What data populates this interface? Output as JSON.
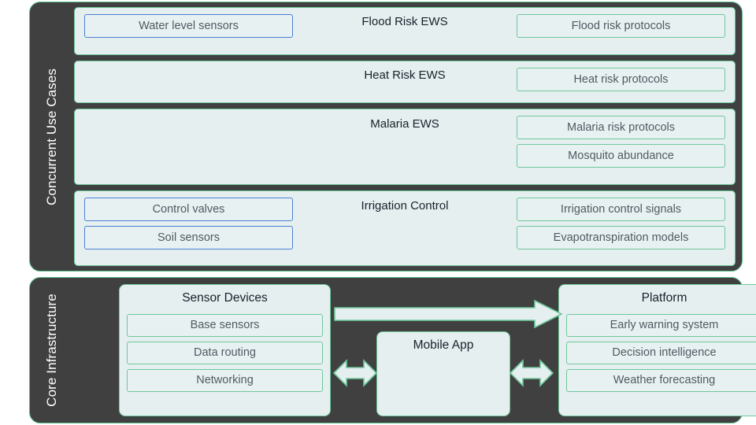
{
  "diagram": {
    "sections": [
      {
        "label": "Concurrent Use Cases",
        "rows": [
          {
            "title": "Flood Risk EWS",
            "left_items": [
              "Water level sensors"
            ],
            "right_items": [
              "Flood risk protocols"
            ]
          },
          {
            "title": "Heat Risk EWS",
            "left_items": [],
            "right_items": [
              "Heat risk protocols"
            ]
          },
          {
            "title": "Malaria EWS",
            "left_items": [],
            "right_items": [
              "Malaria risk protocols",
              "Mosquito abundance"
            ]
          },
          {
            "title": "Irrigation Control",
            "left_items": [
              "Control valves",
              "Soil sensors"
            ],
            "right_items": [
              "Irrigation control signals",
              "Evapotranspiration models"
            ]
          }
        ]
      },
      {
        "label": "Core Infrastructure",
        "boxes": [
          {
            "title": "Sensor Devices",
            "items": [
              "Base sensors",
              "Data routing",
              "Networking"
            ]
          },
          {
            "title": "Mobile App",
            "items": []
          },
          {
            "title": "Platform",
            "items": [
              "Early warning system",
              "Decision intelligence",
              "Weather forecasting"
            ]
          }
        ],
        "arrows": [
          {
            "name": "sensor-to-platform-arrow",
            "direction": "right"
          },
          {
            "name": "sensor-to-mobile-arrow",
            "direction": "both"
          },
          {
            "name": "mobile-to-platform-arrow",
            "direction": "both"
          }
        ]
      }
    ],
    "colors": {
      "panel_background": "#404040",
      "panel_outline": "#5cbf8e",
      "box_fill": "#e5eff0",
      "green_border": "#6fc79b",
      "blue_border": "#4a7fd4",
      "title_text": "#18202a",
      "item_text": "#4f5a61",
      "label_text": "#ffffff"
    }
  }
}
